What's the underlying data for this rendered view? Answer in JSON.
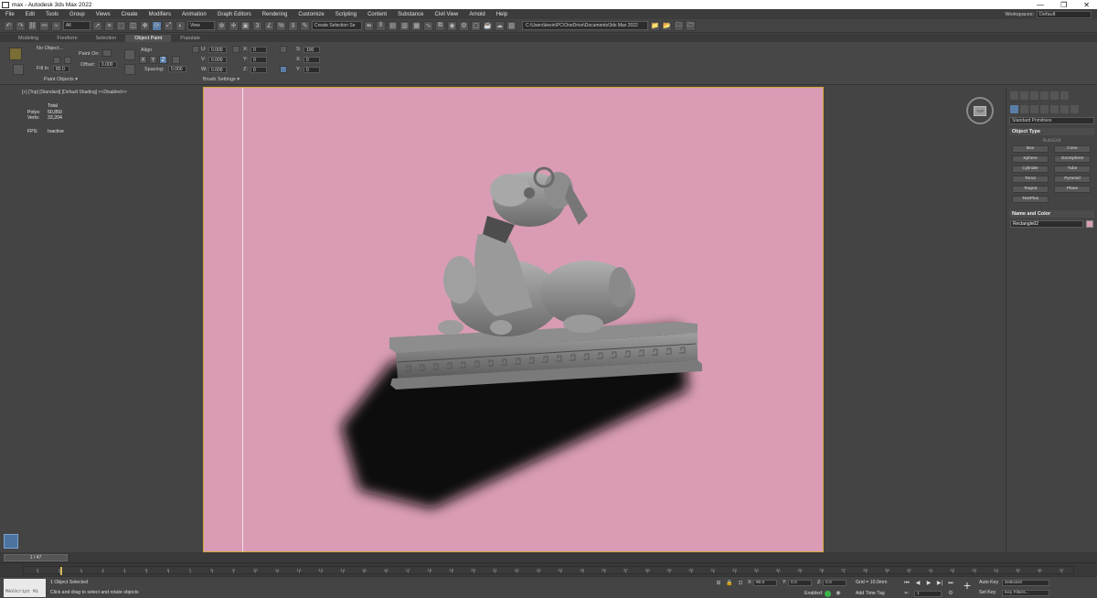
{
  "window": {
    "title": "max - Autodesk 3ds Max 2022",
    "controls": [
      "—",
      "❐",
      "✕"
    ]
  },
  "menu": {
    "items": [
      "File",
      "Edit",
      "Tools",
      "Group",
      "Views",
      "Create",
      "Modifiers",
      "Animation",
      "Graph Editors",
      "Rendering",
      "Customize",
      "Scripting",
      "Content",
      "Substance",
      "Civil View",
      "Arnold",
      "Help"
    ],
    "workspaces_label": "Workspaces:",
    "workspace_value": "Default"
  },
  "toolbar": {
    "selection_filter": "All",
    "ref_coord": "View",
    "named_selection": "Create Selection Se",
    "project_path": "C:\\Users\\kevin\\PC\\OneDrive\\Documents\\3ds Max 2022"
  },
  "ribbon_tabs": [
    "Modeling",
    "Freeform",
    "Selection",
    "Object Paint",
    "Populate"
  ],
  "ribbon": {
    "no_object": "No Object...",
    "paint_on_label": "Paint On:",
    "fill_in_label": "Fill In",
    "fill_in_value": "80.0",
    "offset_label": "Offset:",
    "offset_value": "0.000",
    "align_label": "Align",
    "x": "X",
    "y": "Y",
    "z": "Z",
    "spacing_label": "Spacing:",
    "spacing_value": "0.000",
    "u_label": "U:",
    "v_label": "V:",
    "w_label": "W:",
    "u_value": "0.000",
    "v_value": "0.000",
    "w_value": "0.000",
    "rx_label": "X:",
    "ry_label": "Y:",
    "rz_label": "Z:",
    "rx_value": "0",
    "ry_value": "0",
    "rz_value": "0",
    "sx_label": "X:",
    "sy_label": "Y:",
    "sz_label": "Z:",
    "sx_value": "0",
    "sy_value": "0",
    "sz_value": "0",
    "s_label": "S:",
    "s_value": "100",
    "group_paint_objects": "Paint Objects ▾",
    "group_brush_settings": "Brush Settings ▾"
  },
  "viewport": {
    "label": "[+] [Top] [Standard] [Default Shading] <<Disabled>>",
    "stats_header": "Total",
    "polys_label": "Polys:",
    "polys_value": "50,850",
    "verts_label": "Verts:",
    "verts_value": "33,204",
    "fps_label": "FPS:",
    "fps_value": "Inactive",
    "background_color": "#d99cb4",
    "viewcube_face": "TOP"
  },
  "command_panel": {
    "category": "Standard Primitives",
    "object_type_header": "Object Type",
    "autogrid": "AutoGrid",
    "objects": [
      "Box",
      "Cone",
      "Sphere",
      "GeoSphere",
      "Cylinder",
      "Tube",
      "Torus",
      "Pyramid",
      "Teapot",
      "Plane",
      "TextPlus"
    ],
    "name_color_header": "Name and Color",
    "object_name": "Rectangle02"
  },
  "timeline": {
    "slider": "1 / 47",
    "ticks": [
      "0",
      "1",
      "2",
      "3",
      "4",
      "5",
      "6",
      "7",
      "8",
      "9",
      "10",
      "11",
      "12",
      "13",
      "14",
      "15",
      "16",
      "17",
      "18",
      "19",
      "20",
      "21",
      "22",
      "23",
      "24",
      "25",
      "26",
      "27",
      "28",
      "29",
      "30",
      "31",
      "32",
      "33",
      "34",
      "35",
      "36",
      "37",
      "38",
      "39",
      "40",
      "41",
      "42",
      "43",
      "44",
      "45",
      "46",
      "47"
    ]
  },
  "status": {
    "maxscript": "MAXScript Mi",
    "selected": "1 Object Selected",
    "prompt": "Click and drag to select and rotate objects",
    "x_label": "X:",
    "x_value": "90.0",
    "y_label": "Y:",
    "y_value": "0.0",
    "z_label": "Z:",
    "z_value": "0.0",
    "grid": "Grid = 10.0mm",
    "enabled": "Enabled:",
    "add_time_tag": "Add Time Tag",
    "autokey": "Auto Key",
    "selected_dd": "Selected",
    "setkey": "Set Key",
    "key_filters": "Key Filters...",
    "frame": "1"
  }
}
